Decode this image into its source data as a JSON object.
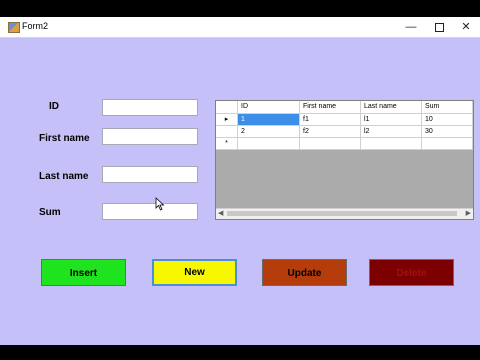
{
  "window": {
    "title": "Form2"
  },
  "title_controls": {
    "minimize": "—",
    "close": "✕"
  },
  "form": {
    "id_label": "ID",
    "first_name_label": "First name",
    "last_name_label": "Last name",
    "sum_label": "Sum",
    "id_value": "",
    "first_name_value": "",
    "last_name_value": "",
    "sum_value": ""
  },
  "grid": {
    "columns": [
      "ID",
      "First name",
      "Last name",
      "Sum"
    ],
    "rows": [
      [
        "1",
        "f1",
        "l1",
        "10"
      ],
      [
        "2",
        "f2",
        "l2",
        "30"
      ]
    ],
    "current_row_marker": "▸",
    "new_row_marker": "*"
  },
  "buttons": {
    "insert": "Insert",
    "new": "New",
    "update": "Update",
    "delete": "Delete"
  },
  "colors": {
    "form_background": "#c5c0f7",
    "insert": "#1fe31f",
    "new": "#f7f700",
    "update": "#b53d0c",
    "delete": "#7d0000"
  }
}
